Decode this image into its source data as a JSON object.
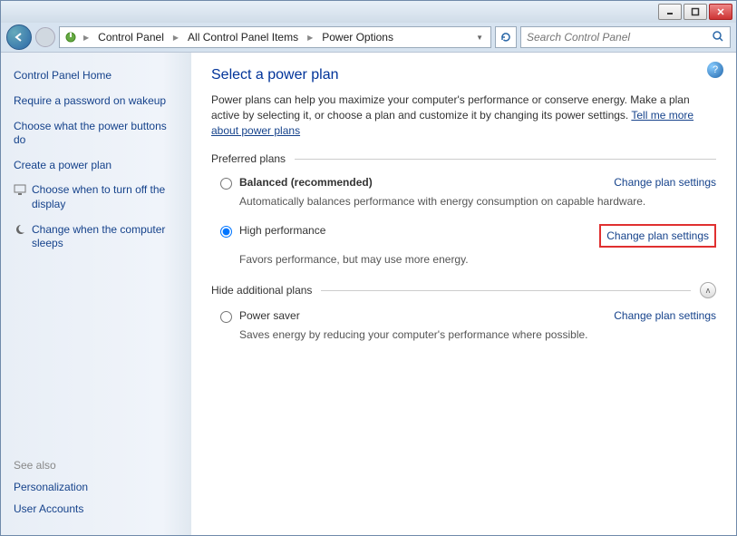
{
  "breadcrumb": {
    "items": [
      "Control Panel",
      "All Control Panel Items",
      "Power Options"
    ]
  },
  "search": {
    "placeholder": "Search Control Panel"
  },
  "sidebar": {
    "home": "Control Panel Home",
    "links": [
      "Require a password on wakeup",
      "Choose what the power buttons do",
      "Create a power plan",
      "Choose when to turn off the display",
      "Change when the computer sleeps"
    ],
    "see_also": "See also",
    "aux": [
      "Personalization",
      "User Accounts"
    ]
  },
  "main": {
    "title": "Select a power plan",
    "desc_before": "Power plans can help you maximize your computer's performance or conserve energy. Make a plan active by selecting it, or choose a plan and customize it by changing its power settings. ",
    "desc_link": "Tell me more about power plans",
    "section_preferred": "Preferred plans",
    "section_additional": "Hide additional plans",
    "change_settings": "Change plan settings",
    "plans": {
      "preferred": [
        {
          "name": "Balanced (recommended)",
          "desc": "Automatically balances performance with energy consumption on capable hardware.",
          "selected": false,
          "bold": true,
          "highlight": false
        },
        {
          "name": "High performance",
          "desc": "Favors performance, but may use more energy.",
          "selected": true,
          "bold": false,
          "highlight": true
        }
      ],
      "additional": [
        {
          "name": "Power saver",
          "desc": "Saves energy by reducing your computer's performance where possible.",
          "selected": false,
          "bold": false,
          "highlight": false
        }
      ]
    }
  }
}
